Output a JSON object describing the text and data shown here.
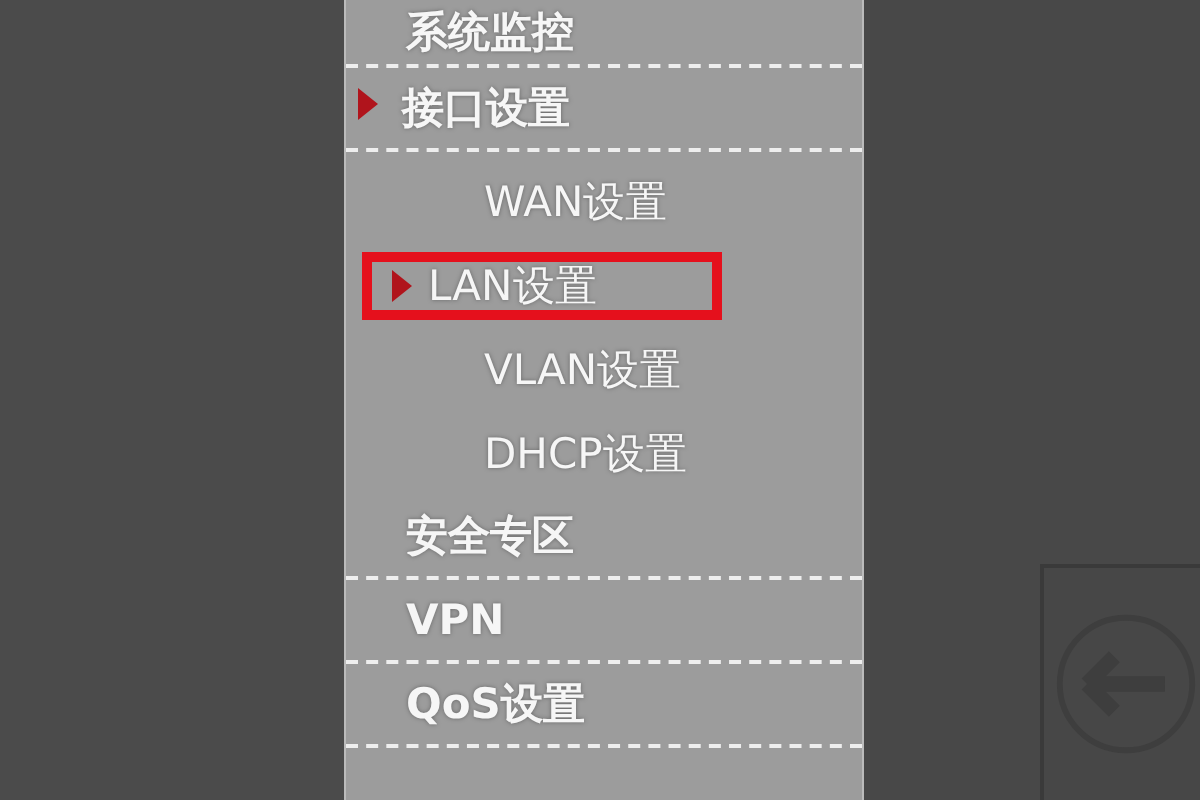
{
  "menu": [
    {
      "label": "系统监控",
      "selected": false
    },
    {
      "label": "接口设置",
      "selected": true,
      "children": [
        {
          "label": "WAN设置",
          "selected": false
        },
        {
          "label": "LAN设置",
          "selected": true
        },
        {
          "label": "VLAN设置",
          "selected": false
        },
        {
          "label": "DHCP设置",
          "selected": false
        }
      ]
    },
    {
      "label": "安全专区",
      "selected": false
    },
    {
      "label": "VPN",
      "selected": false
    },
    {
      "label": "QoS设置",
      "selected": false
    }
  ]
}
